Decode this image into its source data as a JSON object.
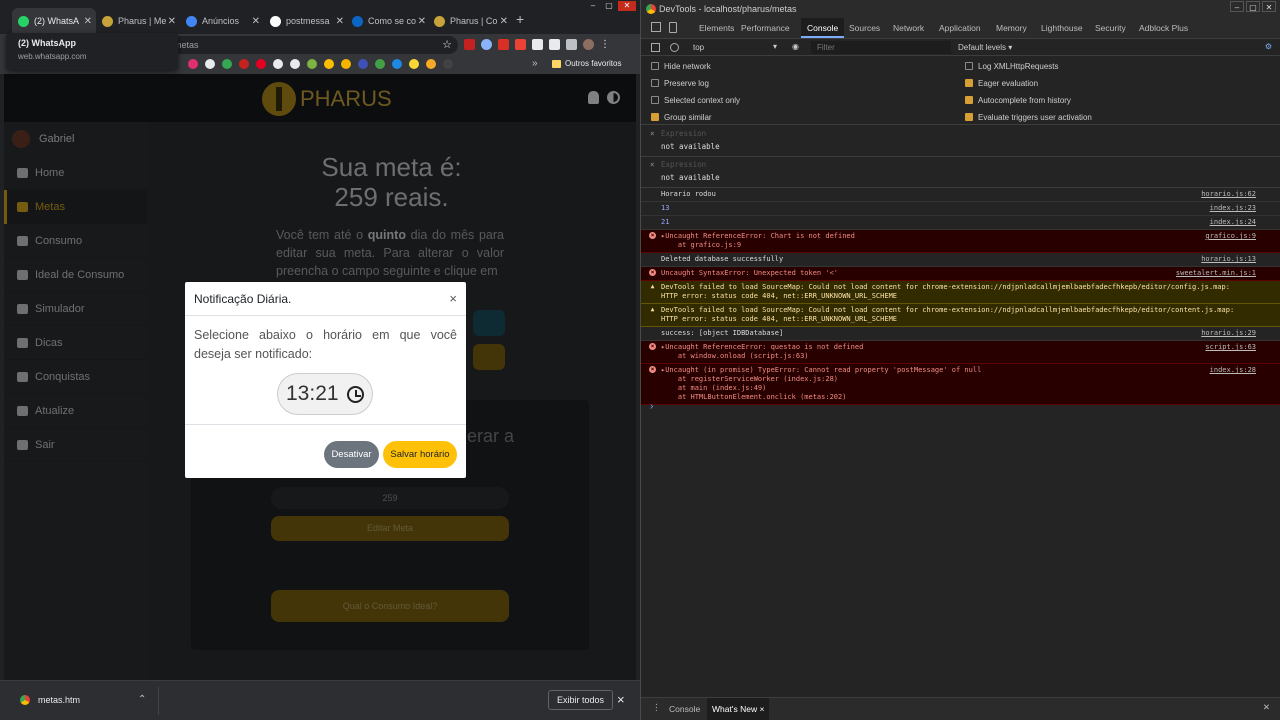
{
  "browser": {
    "tabs": [
      {
        "label": "(2) WhatsA",
        "color": "#25d366"
      },
      {
        "label": "Pharus | Me",
        "color": "#c8a23b"
      },
      {
        "label": "Anúncios",
        "color": "#4285f4"
      },
      {
        "label": "postmessa",
        "color": "#ffffff"
      },
      {
        "label": "Como se co",
        "color": "#0a66c2"
      },
      {
        "label": "Pharus | Co",
        "color": "#c8a23b"
      }
    ],
    "new_tab": "+",
    "url_suffix": "metas",
    "tooltip": {
      "title": "(2) WhatsApp",
      "url": "web.whatsapp.com"
    },
    "bookmarks_more": "»",
    "bookmarks_folder": "Outros favoritos"
  },
  "page": {
    "brand": "PHARUS",
    "user": "Gabriel",
    "nav": [
      {
        "label": "Home"
      },
      {
        "label": "Metas"
      },
      {
        "label": "Consumo"
      },
      {
        "label": "Ideal de Consumo"
      },
      {
        "label": "Simulador"
      },
      {
        "label": "Dicas"
      },
      {
        "label": "Conquistas"
      },
      {
        "label": "Atualize"
      },
      {
        "label": "Sair"
      }
    ],
    "heading_line1": "Sua meta é:",
    "heading_line2": "259 reais.",
    "para_pre": "Você tem até o ",
    "para_bold": "quinto",
    "para_post": " dia do mês para editar sua meta. Para alterar o valor preencha o campo seguinte e clique em",
    "card_ghost": "erar a",
    "meta_value": "259",
    "edit_button": "Editar Meta",
    "ideal_button": "Qual o Consumo Ideal?"
  },
  "modal": {
    "title": "Notificação Diária.",
    "close": "×",
    "body": "Selecione abaixo o horário em que você deseja ser notificado:",
    "time": "13:21",
    "deactivate": "Desativar",
    "save": "Salvar horário"
  },
  "downloads": {
    "file": "metas.htm",
    "show_all": "Exibir todos",
    "close": "×"
  },
  "devtools": {
    "title": "DevTools - localhost/pharus/metas",
    "tabs": [
      "Elements",
      "Performance",
      "Console",
      "Sources",
      "Network",
      "Application",
      "Memory",
      "Lighthouse",
      "Security",
      "Adblock Plus"
    ],
    "active_tab": "Console",
    "badge": "4",
    "context": "top",
    "filter_placeholder": "Filter",
    "levels": "Default levels ▾",
    "options_left": [
      {
        "label": "Hide network",
        "checked": false
      },
      {
        "label": "Preserve log",
        "checked": false
      },
      {
        "label": "Selected context only",
        "checked": false
      },
      {
        "label": "Group similar",
        "checked": true
      }
    ],
    "options_right": [
      {
        "label": "Log XMLHttpRequests",
        "checked": false
      },
      {
        "label": "Eager evaluation",
        "checked": true
      },
      {
        "label": "Autocomplete from history",
        "checked": true
      },
      {
        "label": "Evaluate triggers user activation",
        "checked": true
      }
    ],
    "expressions": [
      {
        "placeholder": "Expression",
        "value": "not available"
      },
      {
        "placeholder": "Expression",
        "value": "not available"
      }
    ],
    "console": [
      {
        "kind": "log",
        "text": "Horario rodou",
        "src": "horario.js:62"
      },
      {
        "kind": "num",
        "text": "13",
        "src": "index.js:23"
      },
      {
        "kind": "num",
        "text": "21",
        "src": "index.js:24"
      },
      {
        "kind": "err",
        "text": "▸Uncaught ReferenceError: Chart is not defined",
        "sub": [
          "    at grafico.js:9"
        ],
        "src": "grafico.js:9"
      },
      {
        "kind": "log",
        "text": "Deleted database successfully",
        "src": "horario.js:13"
      },
      {
        "kind": "err",
        "text": "Uncaught SyntaxError: Unexpected token '<'",
        "src": "sweetalert.min.js:1"
      },
      {
        "kind": "warn",
        "text": "DevTools failed to load SourceMap: Could not load content for chrome-extension://ndjpnladcallmjemlbaebfadecfhkepb/editor/config.js.map:",
        "sub": [
          "HTTP error: status code 404, net::ERR_UNKNOWN_URL_SCHEME"
        ],
        "src": ""
      },
      {
        "kind": "warn",
        "text": "DevTools failed to load SourceMap: Could not load content for chrome-extension://ndjpnladcallmjemlbaebfadecfhkepb/editor/content.js.map:",
        "sub": [
          "HTTP error: status code 404, net::ERR_UNKNOWN_URL_SCHEME"
        ],
        "src": ""
      },
      {
        "kind": "log",
        "text": "success: [object IDBDatabase]",
        "src": "horario.js:29"
      },
      {
        "kind": "err",
        "text": "▸Uncaught ReferenceError: questao is not defined",
        "sub": [
          "    at window.onload (script.js:63)"
        ],
        "src": "script.js:63"
      },
      {
        "kind": "err",
        "text": "▸Uncaught (in promise) TypeError: Cannot read property 'postMessage' of null",
        "sub": [
          "    at registerServiceWorker (index.js:28)",
          "    at main (index.js:49)",
          "    at HTMLButtonElement.onclick (metas:202)"
        ],
        "src": "index.js:28"
      }
    ],
    "prompt": "›",
    "drawer_tabs": [
      "Console",
      "What's New"
    ]
  }
}
